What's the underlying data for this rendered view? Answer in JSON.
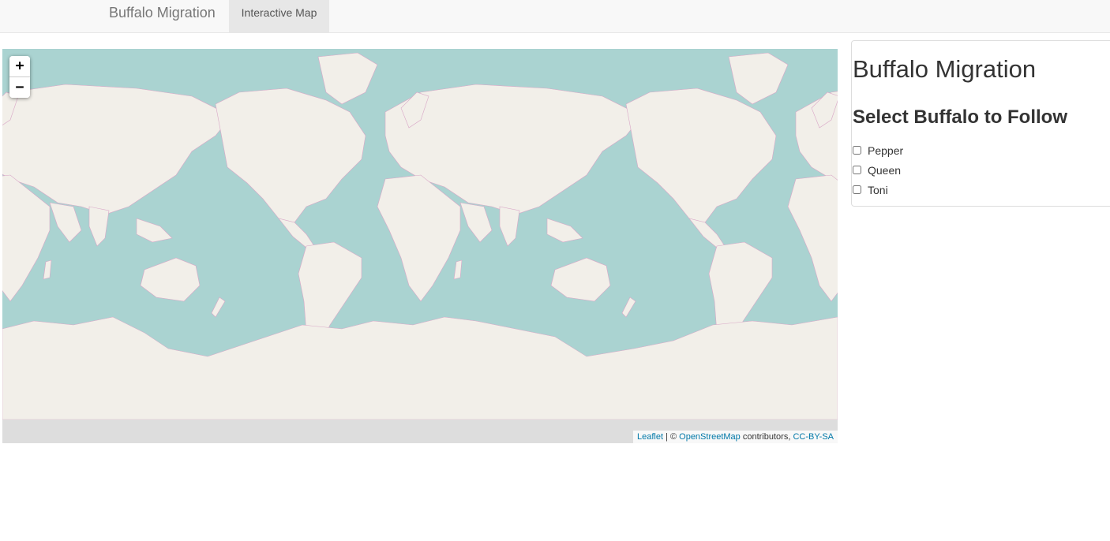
{
  "navbar": {
    "brand": "Buffalo Migration",
    "tab": "Interactive Map"
  },
  "map": {
    "zoom_in": "+",
    "zoom_out": "−",
    "attribution": {
      "leaflet": "Leaflet",
      "separator": " | © ",
      "osm": "OpenStreetMap",
      "contributors": " contributors, ",
      "license": "CC-BY-SA"
    },
    "colors": {
      "water": "#aad3d1",
      "land": "#f2efe9",
      "borders": "#d9a7c7"
    }
  },
  "panel": {
    "title": "Buffalo Migration",
    "subtitle": "Select Buffalo to Follow",
    "options": [
      {
        "label": "Pepper",
        "checked": false
      },
      {
        "label": "Queen",
        "checked": false
      },
      {
        "label": "Toni",
        "checked": false
      }
    ]
  }
}
